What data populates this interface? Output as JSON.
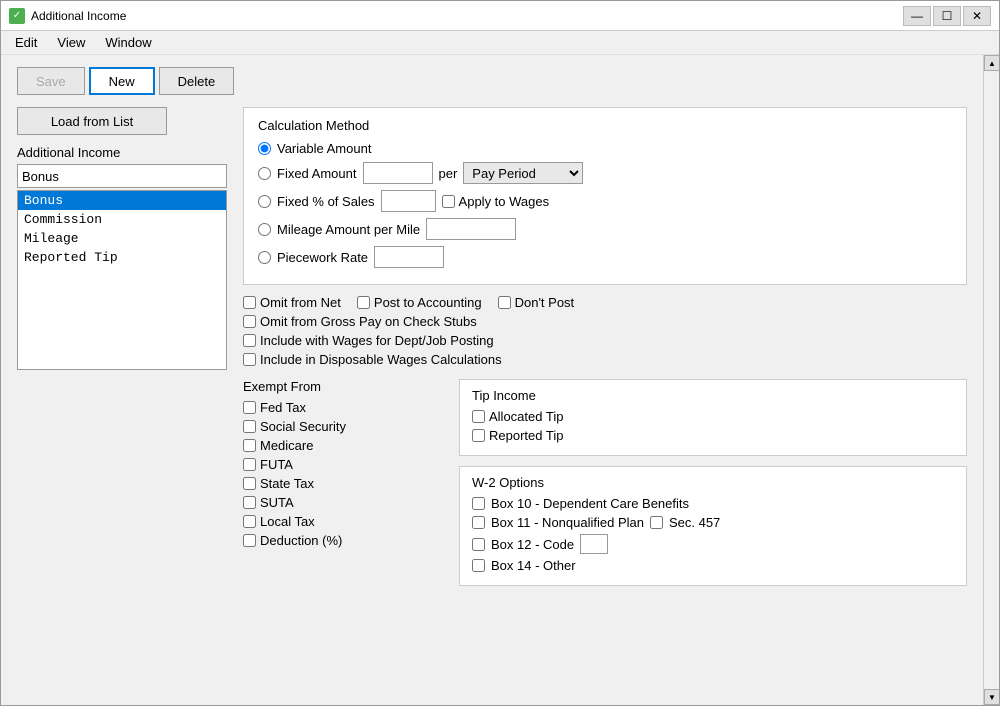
{
  "window": {
    "title": "Additional Income",
    "icon": "✓"
  },
  "menu": {
    "items": [
      "Edit",
      "View",
      "Window"
    ]
  },
  "toolbar": {
    "save_label": "Save",
    "new_label": "New",
    "delete_label": "Delete"
  },
  "left_panel": {
    "load_button": "Load from List",
    "section_label": "Additional Income",
    "current_value": "Bonus",
    "list_items": [
      "Bonus",
      "Commission",
      "Mileage",
      "Reported Tip"
    ],
    "selected_index": 0
  },
  "calculation_method": {
    "title": "Calculation Method",
    "options": [
      {
        "label": "Variable Amount",
        "selected": true
      },
      {
        "label": "Fixed Amount",
        "selected": false
      },
      {
        "label": "Fixed % of Sales",
        "selected": false
      },
      {
        "label": "Mileage Amount per Mile",
        "selected": false
      },
      {
        "label": "Piecework Rate",
        "selected": false
      }
    ],
    "per_label": "per",
    "pay_period": "Pay Period",
    "apply_to_wages": "Apply to Wages"
  },
  "options": {
    "omit_from_net": "Omit from Net",
    "post_to_accounting": "Post to Accounting",
    "dont_post": "Don't Post",
    "omit_from_gross": "Omit from Gross Pay on Check Stubs",
    "include_with_wages": "Include with Wages for Dept/Job Posting",
    "include_in_disposable": "Include in Disposable Wages Calculations"
  },
  "exempt_from": {
    "title": "Exempt From",
    "items": [
      "Fed Tax",
      "Social Security",
      "Medicare",
      "FUTA",
      "State Tax",
      "SUTA",
      "Local Tax",
      "Deduction (%)"
    ]
  },
  "tip_income": {
    "title": "Tip Income",
    "allocated_tip": "Allocated Tip",
    "reported_tip": "Reported Tip"
  },
  "w2_options": {
    "title": "W-2 Options",
    "items": [
      {
        "label": "Box 10 - Dependent Care Benefits"
      },
      {
        "label": "Box 11 - Nonqualified Plan"
      },
      {
        "label": "Sec. 457"
      },
      {
        "label": "Box 12 - Code"
      },
      {
        "label": "Box 14 - Other"
      }
    ]
  }
}
